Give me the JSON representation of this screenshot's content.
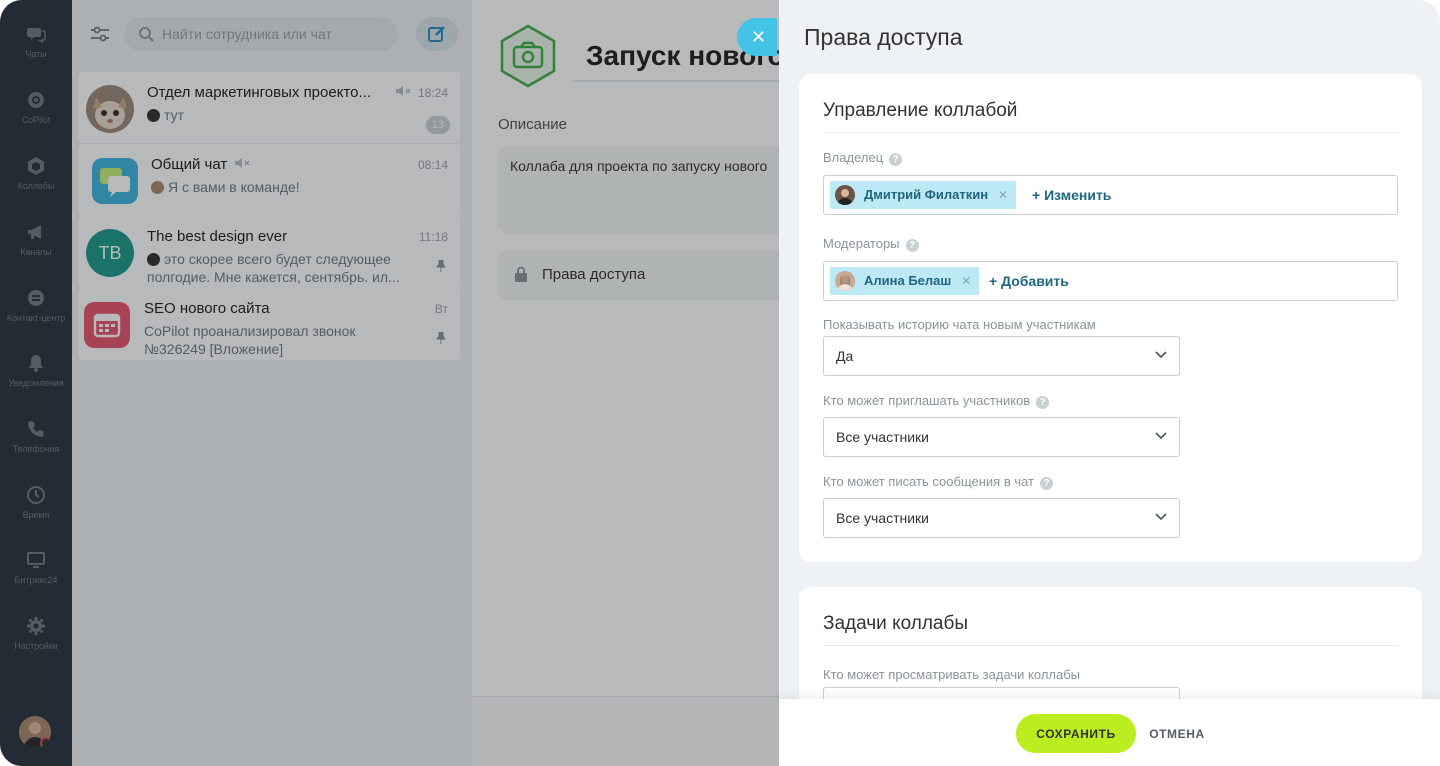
{
  "nav": {
    "items": [
      {
        "label": "Чаты",
        "icon": "chats-icon"
      },
      {
        "label": "CoPilot",
        "icon": "copilot-icon"
      },
      {
        "label": "Коллабы",
        "icon": "collabs-icon"
      },
      {
        "label": "Каналы",
        "icon": "channels-icon"
      },
      {
        "label": "Контакт-центр",
        "icon": "contact-center-icon"
      },
      {
        "label": "Уведомления",
        "icon": "bell-icon"
      },
      {
        "label": "Телефония",
        "icon": "phone-icon"
      },
      {
        "label": "Время",
        "icon": "clock-icon"
      },
      {
        "label": "Битрикс24",
        "icon": "monitor-icon"
      },
      {
        "label": "Настройки",
        "icon": "gear-icon"
      }
    ]
  },
  "chatlist": {
    "search_placeholder": "Найти сотрудника или чат",
    "chats": [
      {
        "title": "Отдел маркетинговых проекто...",
        "time": "18:24",
        "message": "тут",
        "count": "13"
      },
      {
        "title": "Общий чат",
        "time": "08:14",
        "message": "Я с вами в команде!"
      },
      {
        "title": "The best design ever",
        "time": "11:18",
        "initials": "TB",
        "message": "это скорее всего будет следующее полгодие. Мне кажется, сентябрь. ил..."
      },
      {
        "title": "SEO нового сайта",
        "time": "Вт",
        "message": "CoPilot проанализировал звонок №326249 [Вложение]"
      }
    ]
  },
  "collab": {
    "title": "Запуск нового",
    "description_label": "Описание",
    "description": "Коллаба для проекта по запуску нового",
    "access_label": "Права доступа"
  },
  "slider": {
    "title": "Права доступа",
    "management": {
      "title": "Управление коллабой",
      "owner_label": "Владелец",
      "owner_name": "Дмитрий Филаткин",
      "owner_action": "+ Изменить",
      "moderators_label": "Модераторы",
      "moderator_name": "Алина Белаш",
      "moderators_action": "+ Добавить",
      "history_label": "Показывать историю чата новым участникам",
      "history_value": "Да",
      "invite_label": "Кто может приглашать участников",
      "invite_value": "Все участники",
      "write_label": "Кто может писать сообщения в чат",
      "write_value": "Все участники"
    },
    "tasks": {
      "title": "Задачи коллабы",
      "view_label": "Кто может просматривать задачи коллабы"
    },
    "save_label": "СОХРАНИТЬ",
    "cancel_label": "ОТМЕНА"
  },
  "colors": {
    "nav_bg": "#2a3440",
    "accent_green": "#bbed21",
    "tag_bg": "#bde8f5",
    "close_blue": "#43c3e6",
    "collab_green": "#3fb04a"
  }
}
